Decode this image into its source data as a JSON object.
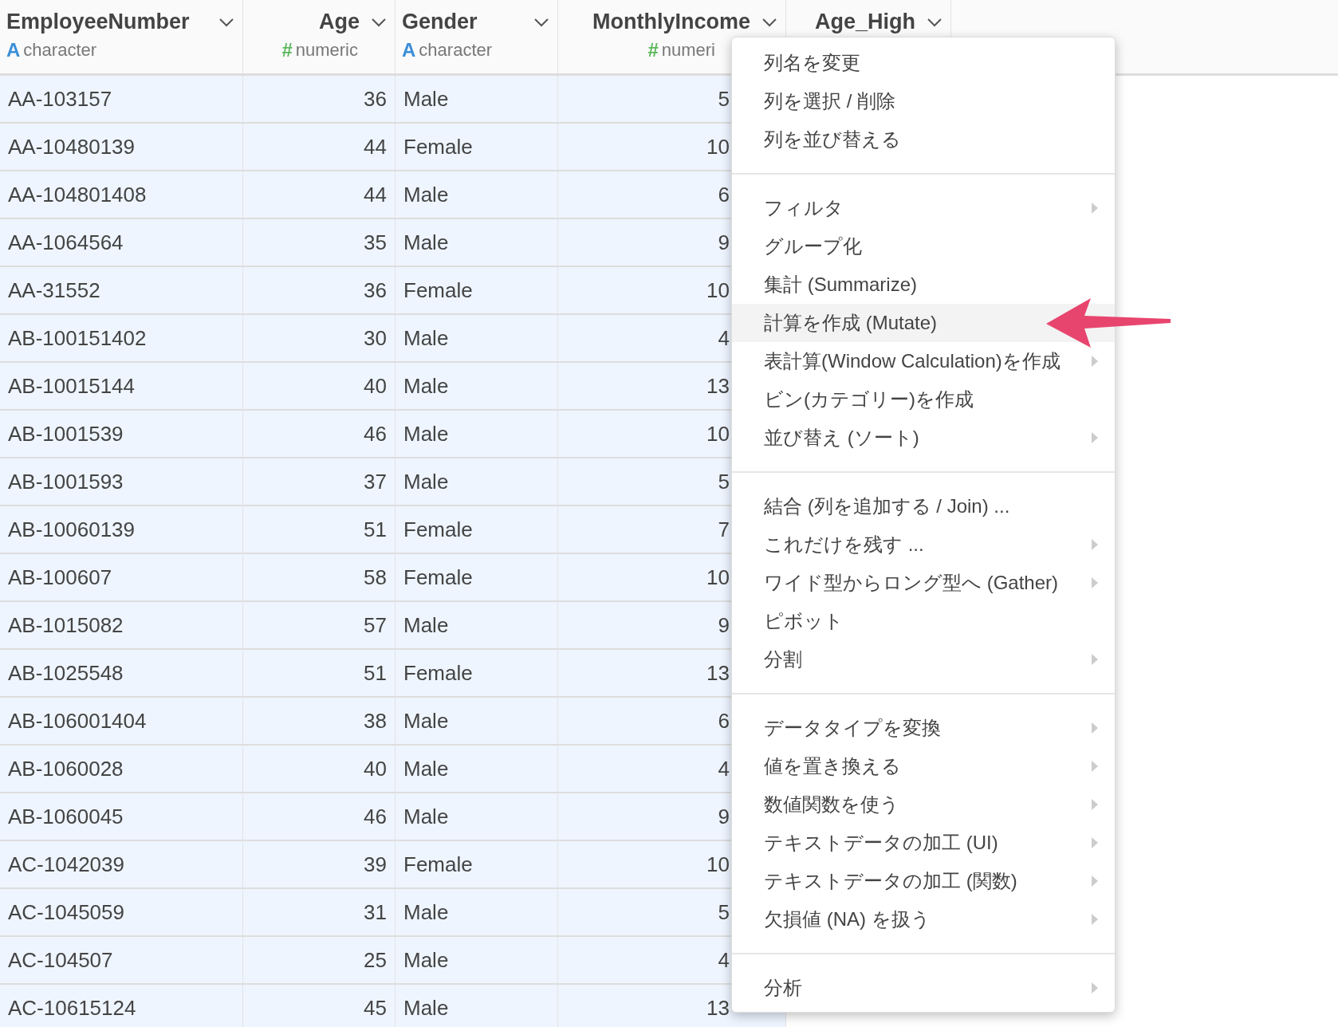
{
  "columns": [
    {
      "name": "EmployeeNumber",
      "type": "character",
      "type_icon": "A",
      "kind": "character"
    },
    {
      "name": "Age",
      "type": "numeric",
      "type_icon": "#",
      "kind": "numeric"
    },
    {
      "name": "Gender",
      "type": "character",
      "type_icon": "A",
      "kind": "character"
    },
    {
      "name": "MonthlyIncome",
      "type": "numeri",
      "type_icon": "#",
      "kind": "numeric"
    },
    {
      "name": "Age_High",
      "kind": "numeric"
    }
  ],
  "rows": [
    [
      "AA-103157",
      "36",
      "Male",
      "5"
    ],
    [
      "AA-10480139",
      "44",
      "Female",
      "10"
    ],
    [
      "AA-104801408",
      "44",
      "Male",
      "6"
    ],
    [
      "AA-1064564",
      "35",
      "Male",
      "9"
    ],
    [
      "AA-31552",
      "36",
      "Female",
      "10"
    ],
    [
      "AB-100151402",
      "30",
      "Male",
      "4"
    ],
    [
      "AB-10015144",
      "40",
      "Male",
      "13"
    ],
    [
      "AB-1001539",
      "46",
      "Male",
      "10"
    ],
    [
      "AB-1001593",
      "37",
      "Male",
      "5"
    ],
    [
      "AB-10060139",
      "51",
      "Female",
      "7"
    ],
    [
      "AB-100607",
      "58",
      "Female",
      "10"
    ],
    [
      "AB-1015082",
      "57",
      "Male",
      "9"
    ],
    [
      "AB-1025548",
      "51",
      "Female",
      "13"
    ],
    [
      "AB-106001404",
      "38",
      "Male",
      "6"
    ],
    [
      "AB-1060028",
      "40",
      "Male",
      "4"
    ],
    [
      "AB-1060045",
      "46",
      "Male",
      "9"
    ],
    [
      "AC-1042039",
      "39",
      "Female",
      "10"
    ],
    [
      "AC-1045059",
      "31",
      "Male",
      "5"
    ],
    [
      "AC-104507",
      "25",
      "Male",
      "4"
    ],
    [
      "AC-10615124",
      "45",
      "Male",
      "13"
    ]
  ],
  "menu": {
    "groups": [
      [
        {
          "label": "列名を変更",
          "submenu": false,
          "selected": false
        },
        {
          "label": "列を選択 / 削除",
          "submenu": false,
          "selected": false
        },
        {
          "label": "列を並び替える",
          "submenu": false,
          "selected": false
        }
      ],
      [
        {
          "label": "フィルタ",
          "submenu": true,
          "selected": false
        },
        {
          "label": "グループ化",
          "submenu": false,
          "selected": false
        },
        {
          "label": "集計 (Summarize)",
          "submenu": false,
          "selected": false
        },
        {
          "label": "計算を作成 (Mutate)",
          "submenu": false,
          "selected": true
        },
        {
          "label": "表計算(Window Calculation)を作成",
          "submenu": true,
          "selected": false
        },
        {
          "label": "ビン(カテゴリー)を作成",
          "submenu": false,
          "selected": false
        },
        {
          "label": "並び替え (ソート)",
          "submenu": true,
          "selected": false
        }
      ],
      [
        {
          "label": "結合 (列を追加する / Join) ...",
          "submenu": false,
          "selected": false
        },
        {
          "label": "これだけを残す ...",
          "submenu": true,
          "selected": false
        },
        {
          "label": "ワイド型からロング型へ (Gather)",
          "submenu": true,
          "selected": false
        },
        {
          "label": "ピボット",
          "submenu": false,
          "selected": false
        },
        {
          "label": "分割",
          "submenu": true,
          "selected": false
        }
      ],
      [
        {
          "label": "データタイプを変換",
          "submenu": true,
          "selected": false
        },
        {
          "label": "値を置き換える",
          "submenu": true,
          "selected": false
        },
        {
          "label": "数値関数を使う",
          "submenu": true,
          "selected": false
        },
        {
          "label": "テキストデータの加工 (UI)",
          "submenu": true,
          "selected": false
        },
        {
          "label": "テキストデータの加工 (関数)",
          "submenu": true,
          "selected": false
        },
        {
          "label": "欠損値 (NA) を扱う",
          "submenu": true,
          "selected": false
        }
      ],
      [
        {
          "label": "分析",
          "submenu": true,
          "selected": false
        }
      ]
    ]
  }
}
